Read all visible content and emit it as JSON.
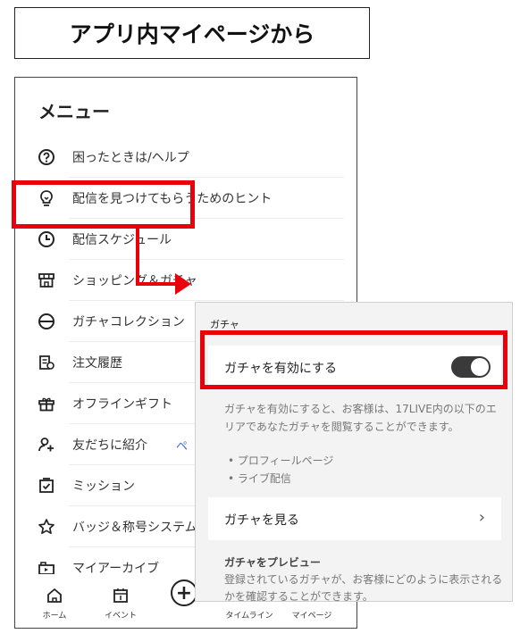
{
  "title": "アプリ内マイページから",
  "menu": {
    "heading": "メニュー",
    "items": [
      {
        "label": "困ったときは/ヘルプ",
        "icon": "question-icon"
      },
      {
        "label": "配信を見つけてもらうためのヒント",
        "icon": "lightbulb-icon"
      },
      {
        "label": "配信スケジュール",
        "icon": "clock-icon"
      },
      {
        "label": "ショッピング＆ガチャ",
        "icon": "shop-icon"
      },
      {
        "label": "ガチャコレクション",
        "icon": "capsule-icon"
      },
      {
        "label": "注文履歴",
        "icon": "order-history-icon"
      },
      {
        "label": "オフラインギフト",
        "icon": "gift-icon"
      },
      {
        "label": "友だちに紹介",
        "icon": "add-friend-icon",
        "extra": "ペ"
      },
      {
        "label": "ミッション",
        "icon": "checklist-icon"
      },
      {
        "label": "バッジ＆称号システム",
        "icon": "star-icon"
      },
      {
        "label": "マイアーカイブ",
        "icon": "archive-icon"
      }
    ]
  },
  "bottom_nav": {
    "home": "ホーム",
    "event": "イベント",
    "plus": "+",
    "timeline": "タイムライン",
    "mypage": "マイページ"
  },
  "panel": {
    "heading": "ガチャ",
    "toggle_label": "ガチャを有効にする",
    "toggle_on": true,
    "description": "ガチャを有効にすると、お客様は、17LIVE内の以下のエリアであなたガチャを閲覧することができます。",
    "bullets": [
      "• プロフィールページ",
      "• ライブ配信"
    ],
    "view_label": "ガチャを見る",
    "chevron": "›",
    "preview_title": "ガチャをプレビュー",
    "preview_desc": "登録されているガチャが、お客様にどのように表示されるかを確認することができます。"
  },
  "colors": {
    "highlight": "#e8000b",
    "toggle_track": "#3a3a3a",
    "panel_bg": "#f3f3f4",
    "link": "#3a6bd6"
  }
}
